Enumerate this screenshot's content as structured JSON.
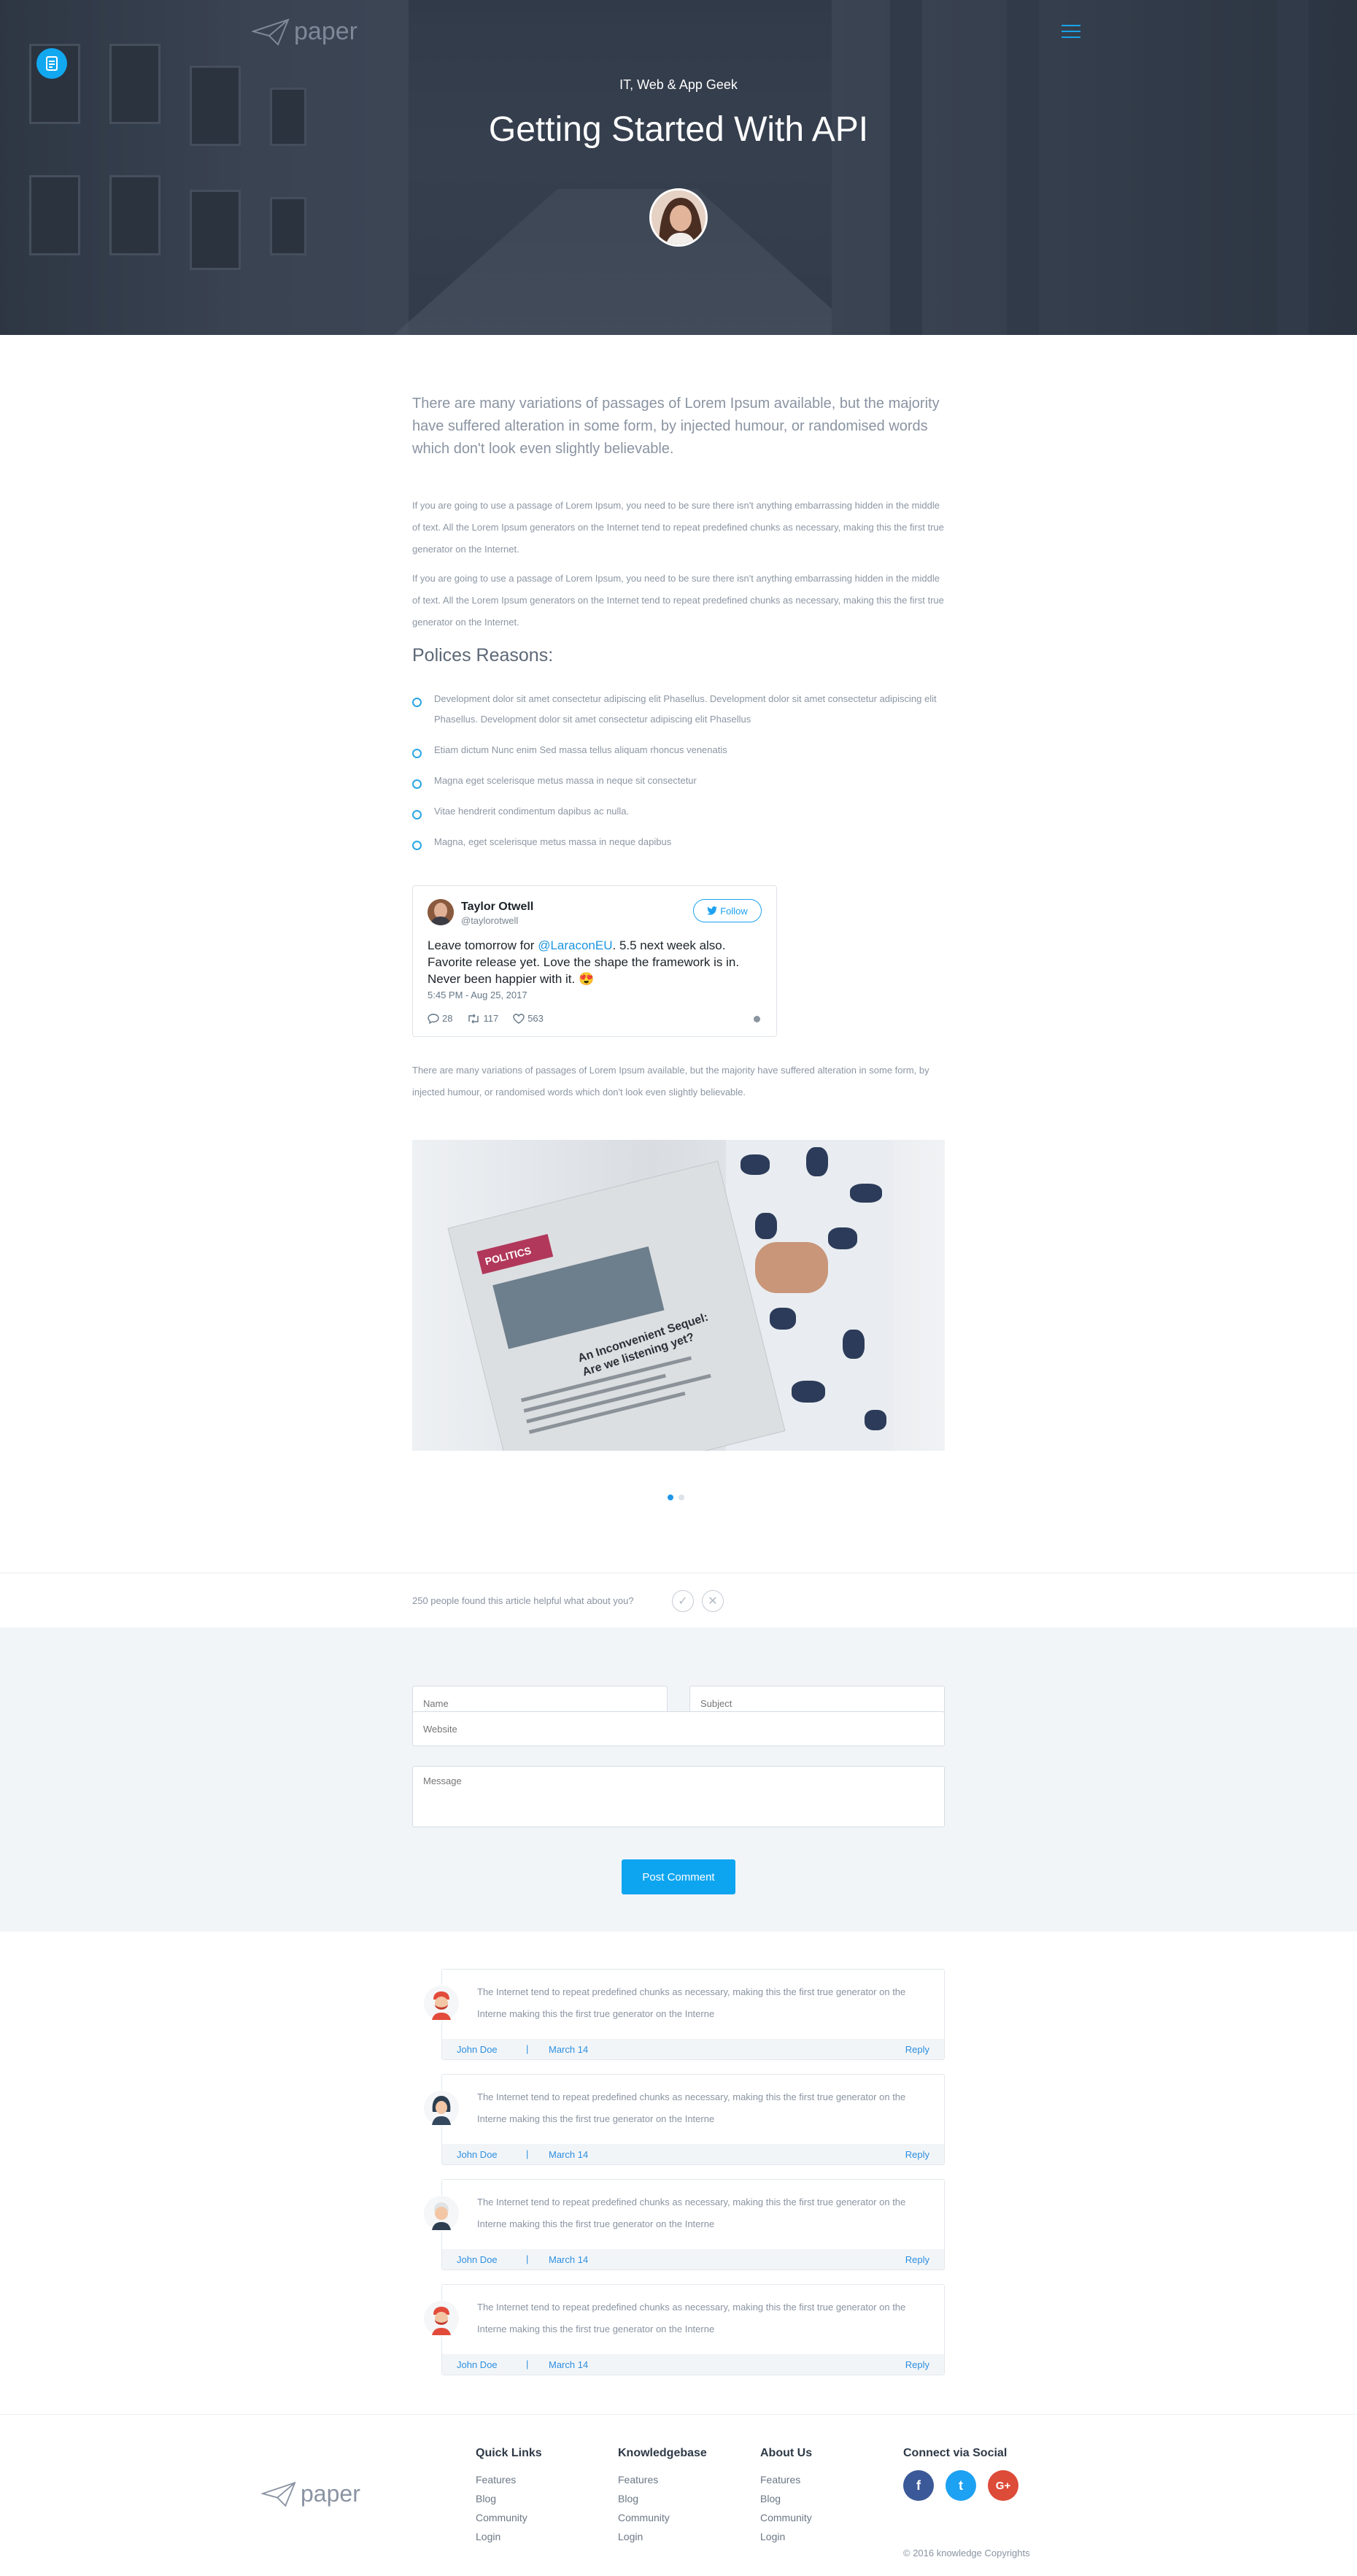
{
  "header": {
    "logo_text": "paper",
    "category": "IT, Web & App Geek",
    "title": "Getting Started With API"
  },
  "article": {
    "lead": "There are many variations of passages of Lorem Ipsum available, but the majority have suffered alteration in some form, by injected humour, or randomised words which don't look even slightly believable.",
    "paragraphs": [
      "If you are going to use a passage of Lorem Ipsum, you need to be sure there isn't anything embarrassing hidden in the middle of text. All the Lorem Ipsum generators on the Internet tend to repeat predefined chunks as necessary, making this the first true generator on the Internet.",
      "If you are going to use a passage of Lorem Ipsum, you need to be sure there isn't anything embarrassing hidden in the middle of text. All the Lorem Ipsum generators on the Internet tend to repeat predefined chunks as necessary, making this the first true generator on the Internet."
    ],
    "section_heading": "Polices Reasons:",
    "bullets": [
      "Development dolor sit amet consectetur adipiscing elit Phasellus. Development dolor sit amet consectetur adipiscing elit Phasellus. Development dolor sit amet consectetur adipiscing elit Phasellus",
      "Etiam dictum Nunc enim Sed massa tellus aliquam rhoncus venenatis",
      "Magna eget scelerisque metus massa in neque sit consectetur",
      "Vitae hendrerit condimentum dapibus ac nulla.",
      "Magna, eget scelerisque metus massa in neque dapibus"
    ],
    "closing": "There are many variations of passages of Lorem Ipsum available, but the majority have suffered alteration in some form, by injected humour, or randomised words which don't look even slightly believable."
  },
  "tweet": {
    "name": "Taylor Otwell",
    "handle": "@taylorotwell",
    "follow_label": "Follow",
    "text_before": "Leave tomorrow for ",
    "mention": "@LaraconEU",
    "text_after": ". 5.5 next week also. Favorite release yet. Love the shape the framework is in. Never been happier with it. 😍",
    "timestamp": "5:45 PM - Aug 25, 2017",
    "replies": "28",
    "retweets": "117",
    "likes": "563"
  },
  "photo": {
    "paper_band": "POLITICS",
    "paper_headline": "An Inconvenient Sequel: Are we listening yet?"
  },
  "slider": {
    "active_index": 0,
    "count": 2
  },
  "helpful": {
    "text": "250 people found this article helpful what about you?",
    "yes_icon": "✓",
    "no_icon": "✕"
  },
  "form": {
    "name_placeholder": "Name",
    "subject_placeholder": "Subject",
    "website_placeholder": "Website",
    "message_placeholder": "Message",
    "submit_label": "Post Comment"
  },
  "comments": [
    {
      "text": "The Internet tend to repeat predefined chunks as necessary, making this the first true generator on the Interne making this the first true generator on the Interne",
      "author": "John Doe",
      "separator": "|",
      "date": "March 14",
      "reply": "Reply"
    },
    {
      "text": "The Internet tend to repeat predefined chunks as necessary, making this the first true generator on the Interne making this the first true generator on the Interne",
      "author": "John Doe",
      "separator": "|",
      "date": "March 14",
      "reply": "Reply"
    },
    {
      "text": "The Internet tend to repeat predefined chunks as necessary, making this the first true generator on the Interne making this the first true generator on the Interne",
      "author": "John Doe",
      "separator": "|",
      "date": "March 14",
      "reply": "Reply"
    },
    {
      "text": "The Internet tend to repeat predefined chunks as necessary, making this the first true generator on the Interne making this the first true generator on the Interne",
      "author": "John Doe",
      "separator": "|",
      "date": "March 14",
      "reply": "Reply"
    }
  ],
  "footer": {
    "logo_text": "paper",
    "columns": [
      {
        "title": "Quick Links",
        "links": [
          "Features",
          "Blog",
          "Community",
          "Login"
        ]
      },
      {
        "title": "Knowledgebase",
        "links": [
          "Features",
          "Blog",
          "Community",
          "Login"
        ]
      },
      {
        "title": "About Us",
        "links": [
          "Features",
          "Blog",
          "Community",
          "Login"
        ]
      }
    ],
    "social_title": "Connect via Social",
    "social": [
      {
        "icon": "facebook-icon",
        "glyph": "f",
        "color": "#3b5998"
      },
      {
        "icon": "twitter-icon",
        "glyph": "t",
        "color": "#1da1f2"
      },
      {
        "icon": "google-plus-icon",
        "glyph": "G+",
        "color": "#dd4b39"
      }
    ],
    "copyright": "© 2016 knowledge Copyrights"
  },
  "colors": {
    "accent": "#0ea5f0",
    "link": "#2d8fe0",
    "hero_overlay": "#3a4352"
  }
}
